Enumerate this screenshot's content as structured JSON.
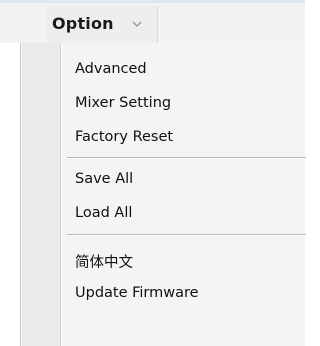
{
  "menubar": {
    "title": "Option",
    "chevron_icon": "chevron-down-icon"
  },
  "dropdown": {
    "groups": [
      {
        "items": [
          {
            "label": "Advanced"
          },
          {
            "label": "Mixer Setting"
          },
          {
            "label": "Factory Reset"
          }
        ]
      },
      {
        "items": [
          {
            "label": "Save All"
          },
          {
            "label": "Load All"
          }
        ]
      },
      {
        "items": [
          {
            "label": "简体中文"
          },
          {
            "label": "Update Firmware"
          }
        ]
      }
    ]
  }
}
